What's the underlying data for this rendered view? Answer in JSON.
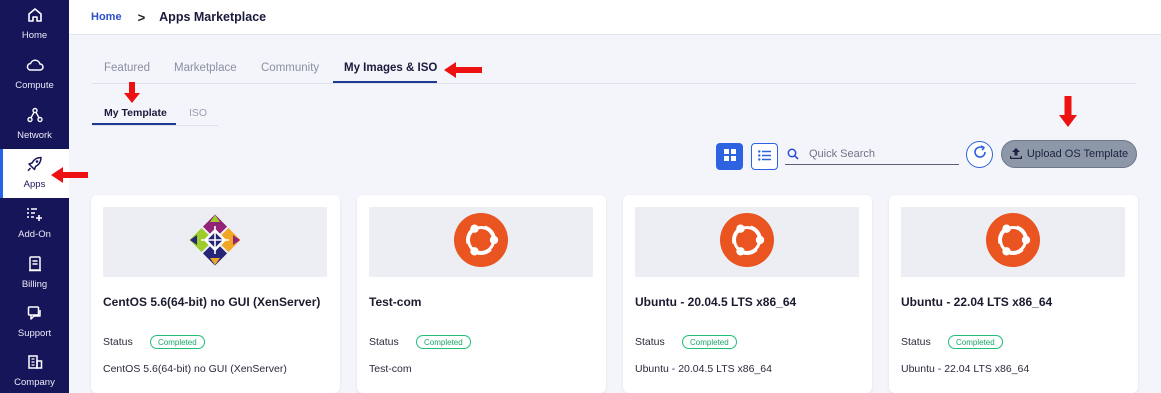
{
  "sidebar": {
    "items": [
      {
        "label": "Home",
        "icon": "home-icon"
      },
      {
        "label": "Compute",
        "icon": "cloud-icon"
      },
      {
        "label": "Network",
        "icon": "network-icon"
      },
      {
        "label": "Apps",
        "icon": "rocket-icon",
        "active": true
      },
      {
        "label": "Add-On",
        "icon": "add-list-icon"
      },
      {
        "label": "Billing",
        "icon": "billing-icon"
      },
      {
        "label": "Support",
        "icon": "support-icon"
      },
      {
        "label": "Company",
        "icon": "company-icon"
      }
    ]
  },
  "breadcrumb": {
    "home": "Home",
    "separator": ">",
    "title": "Apps Marketplace"
  },
  "tabs": [
    {
      "label": "Featured"
    },
    {
      "label": "Marketplace"
    },
    {
      "label": "Community"
    },
    {
      "label": "My Images & ISO",
      "active": true
    }
  ],
  "subtabs": [
    {
      "label": "My Template",
      "active": true
    },
    {
      "label": "ISO"
    }
  ],
  "toolbar": {
    "search_placeholder": "Quick Search",
    "upload_label": "Upload OS Template"
  },
  "cards": [
    {
      "name": "CentOS 5.6(64-bit) no GUI (XenServer)",
      "status_label": "Status",
      "status": "Completed",
      "description": "CentOS 5.6(64-bit) no GUI (XenServer)",
      "logo": "centos-logo"
    },
    {
      "name": "Test-com",
      "status_label": "Status",
      "status": "Completed",
      "description": "Test-com",
      "logo": "ubuntu-logo"
    },
    {
      "name": "Ubuntu - 20.04.5 LTS x86_64",
      "status_label": "Status",
      "status": "Completed",
      "description": "Ubuntu - 20.04.5 LTS x86_64",
      "logo": "ubuntu-logo"
    },
    {
      "name": "Ubuntu - 22.04 LTS x86_64",
      "status_label": "Status",
      "status": "Completed",
      "description": "Ubuntu - 22.04 LTS x86_64",
      "logo": "ubuntu-logo"
    }
  ],
  "colors": {
    "sidebar": "#17155a",
    "accent": "#2d63e0",
    "status_green": "#1fbf75",
    "ubuntu_orange": "#e95420",
    "annotation_red": "#ee1111"
  }
}
